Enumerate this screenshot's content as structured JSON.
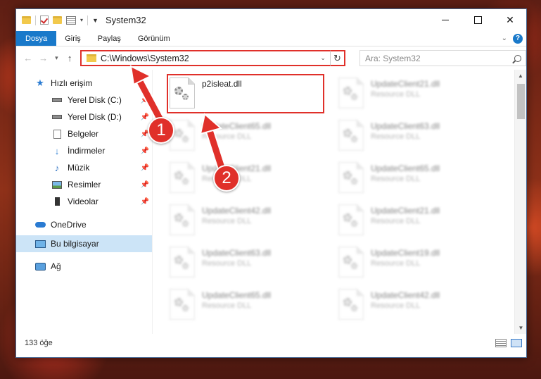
{
  "window": {
    "title": "System32"
  },
  "ribbon": {
    "tabs": [
      "Dosya",
      "Giriş",
      "Paylaş",
      "Görünüm"
    ],
    "help_label": "?"
  },
  "address": {
    "path": "C:\\Windows\\System32",
    "search_placeholder": "Ara: System32"
  },
  "sidebar": {
    "quick_access": "Hızlı erişim",
    "items": [
      {
        "label": "Yerel Disk (C:)",
        "icon": "drive-icon"
      },
      {
        "label": "Yerel Disk (D:)",
        "icon": "drive-icon"
      },
      {
        "label": "Belgeler",
        "icon": "documents-icon"
      },
      {
        "label": "İndirmeler",
        "icon": "downloads-icon"
      },
      {
        "label": "Müzik",
        "icon": "music-icon"
      },
      {
        "label": "Resimler",
        "icon": "pictures-icon"
      },
      {
        "label": "Videolar",
        "icon": "videos-icon"
      }
    ],
    "onedrive": "OneDrive",
    "this_pc": "Bu bilgisayar",
    "network": "Ağ"
  },
  "files": [
    {
      "name": "p2isleat.dll",
      "type": ""
    },
    {
      "name": "UpdateClient21.dll",
      "type": "Resource DLL"
    },
    {
      "name": "UpdateClient65.dll",
      "type": "Resource DLL"
    },
    {
      "name": "UpdateClient63.dll",
      "type": "Resource DLL"
    },
    {
      "name": "UpdateClient21.dll",
      "type": "Resource DLL"
    },
    {
      "name": "UpdateClient65.dll",
      "type": "Resource DLL"
    },
    {
      "name": "UpdateClient42.dll",
      "type": "Resource DLL"
    },
    {
      "name": "UpdateClient21.dll",
      "type": "Resource DLL"
    },
    {
      "name": "UpdateClient63.dll",
      "type": "Resource DLL"
    },
    {
      "name": "UpdateClient19.dll",
      "type": "Resource DLL"
    },
    {
      "name": "UpdateClient65.dll",
      "type": "Resource DLL"
    },
    {
      "name": "UpdateClient42.dll",
      "type": "Resource DLL"
    }
  ],
  "status": {
    "count": "133 öğe"
  },
  "annotations": {
    "step1": "1",
    "step2": "2"
  },
  "colors": {
    "accent": "#1979ca",
    "highlight": "#e0302a",
    "selection": "#cce4f7"
  }
}
